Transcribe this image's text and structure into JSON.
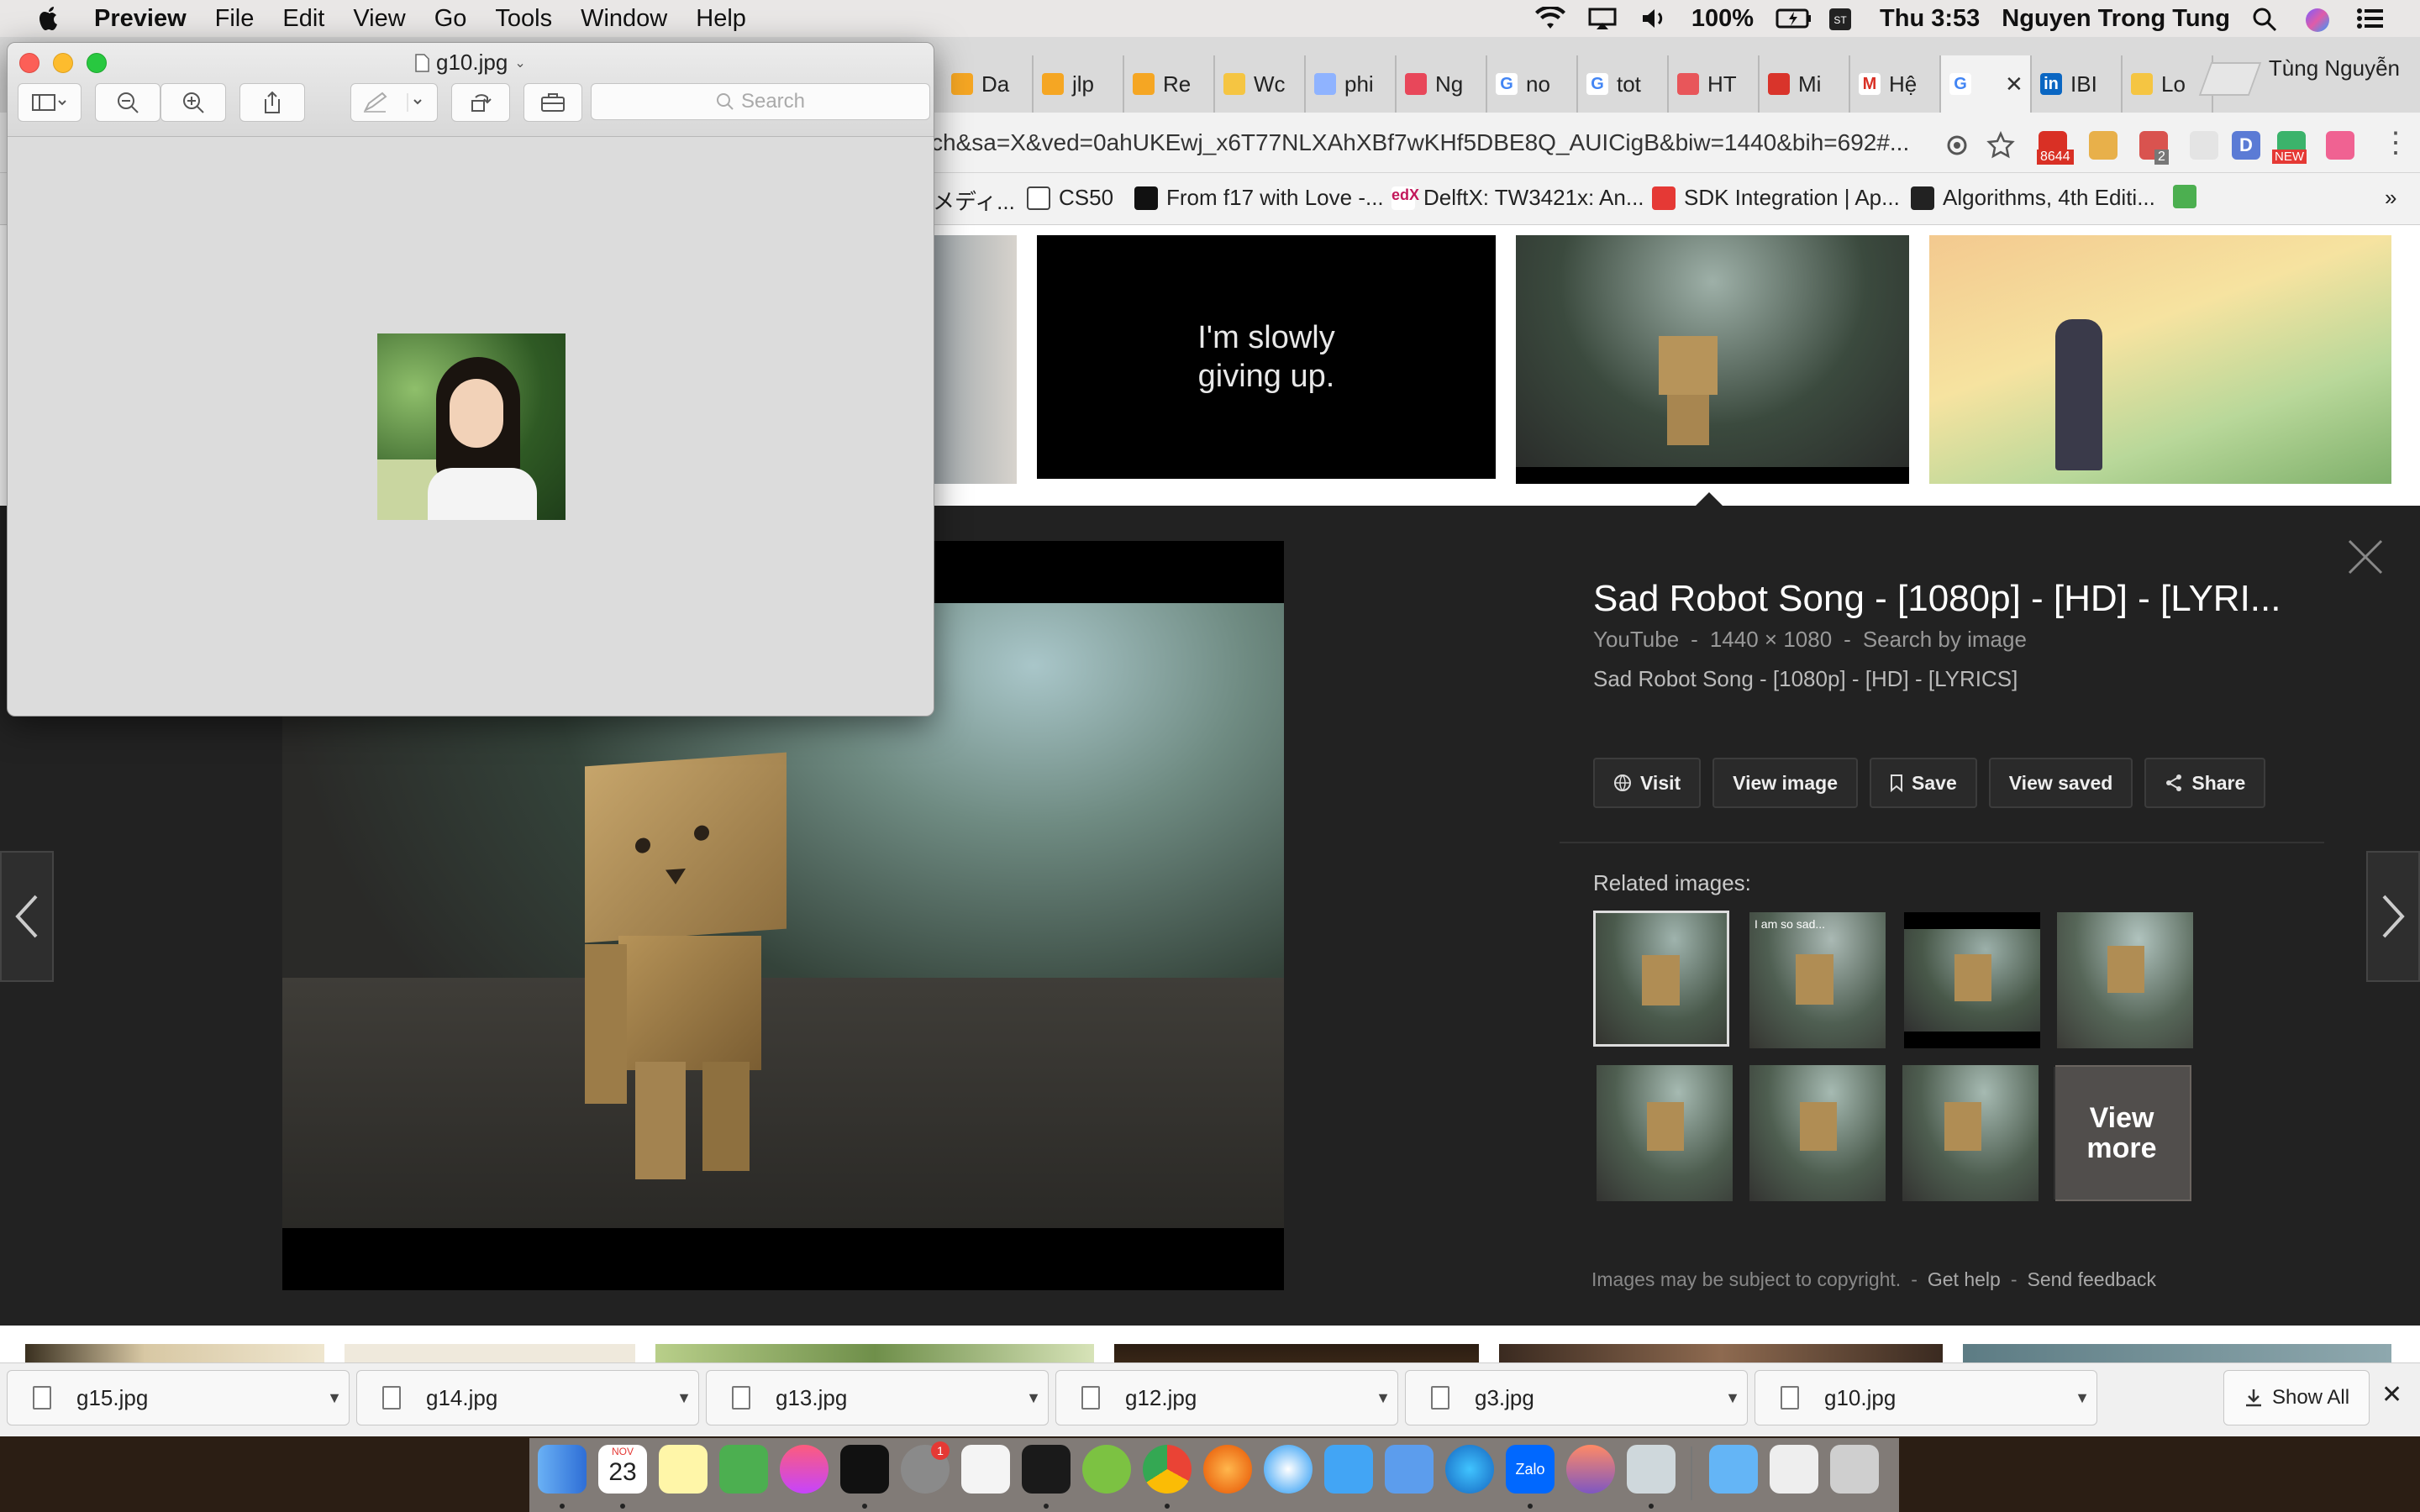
{
  "menubar": {
    "app": "Preview",
    "items": [
      "File",
      "Edit",
      "View",
      "Go",
      "Tools",
      "Window",
      "Help"
    ],
    "battery": "100%",
    "clock": "Thu 3:53",
    "user": "Nguyen Trong Tung"
  },
  "preview": {
    "filename": "g10.jpg",
    "search_placeholder": "Search"
  },
  "chrome": {
    "tabs": [
      "Da",
      "jlp",
      "Re",
      "Wc",
      "phi",
      "Ng",
      "no",
      "tot",
      "HT",
      "Mi",
      "Hệ",
      "",
      "IBI",
      "Lo"
    ],
    "profile": "Tùng Nguyễn",
    "url": "ch&sa=X&ved=0ahUKEwj_x6T77NLXAhXBf7wKHf5DBE8Q_AUICigB&biw=1440&bih=692#...",
    "badges": {
      "gmail": "8644",
      "ext2": "2",
      "new": "NEW"
    },
    "bookmarks": [
      "メディ...",
      "CS50",
      "From f17 with Love -...",
      "DelftX: TW3421x: An...",
      "SDK Integration | Ap...",
      "Algorithms, 4th Editi..."
    ],
    "bookmarks_more": "»"
  },
  "results": {
    "text_thumb": "I'm slowly giving up."
  },
  "panel": {
    "title": "Sad Robot Song - [1080p] - [HD] - [LYRI...",
    "source": "YouTube",
    "dims": "1440 × 1080",
    "search_by_image": "Search by image",
    "description": "Sad Robot Song - [1080p] - [HD] - [LYRICS]",
    "actions": [
      "Visit",
      "View image",
      "Save",
      "View saved",
      "Share"
    ],
    "related_label": "Related images:",
    "related_caption": "I am so sad...",
    "view_more": "View more",
    "footer_note": "Images may be subject to copyright.",
    "get_help": "Get help",
    "send_feedback": "Send feedback",
    "sep": "-"
  },
  "downloads": {
    "files": [
      "g15.jpg",
      "g14.jpg",
      "g13.jpg",
      "g12.jpg",
      "g3.jpg",
      "g10.jpg"
    ],
    "show_all": "Show All"
  },
  "dock": {
    "calendar_month": "NOV",
    "calendar_day": "23",
    "zalo": "Zalo",
    "badge": "1"
  }
}
